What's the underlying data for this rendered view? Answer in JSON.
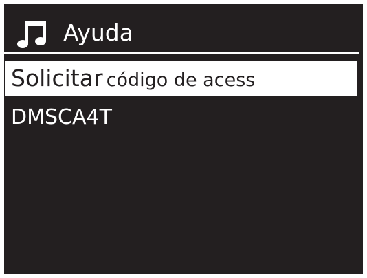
{
  "header": {
    "icon": "music-note-icon",
    "title": "Ayuda"
  },
  "menu": {
    "items": [
      {
        "label_main": "Solicitar",
        "label_rest": "código de acess",
        "selected": true
      },
      {
        "label": "DMSCA4T",
        "selected": false
      }
    ]
  },
  "colors": {
    "background": "#231f20",
    "foreground": "#ffffff",
    "highlight": "#ffffff",
    "highlight_text": "#231f20"
  }
}
